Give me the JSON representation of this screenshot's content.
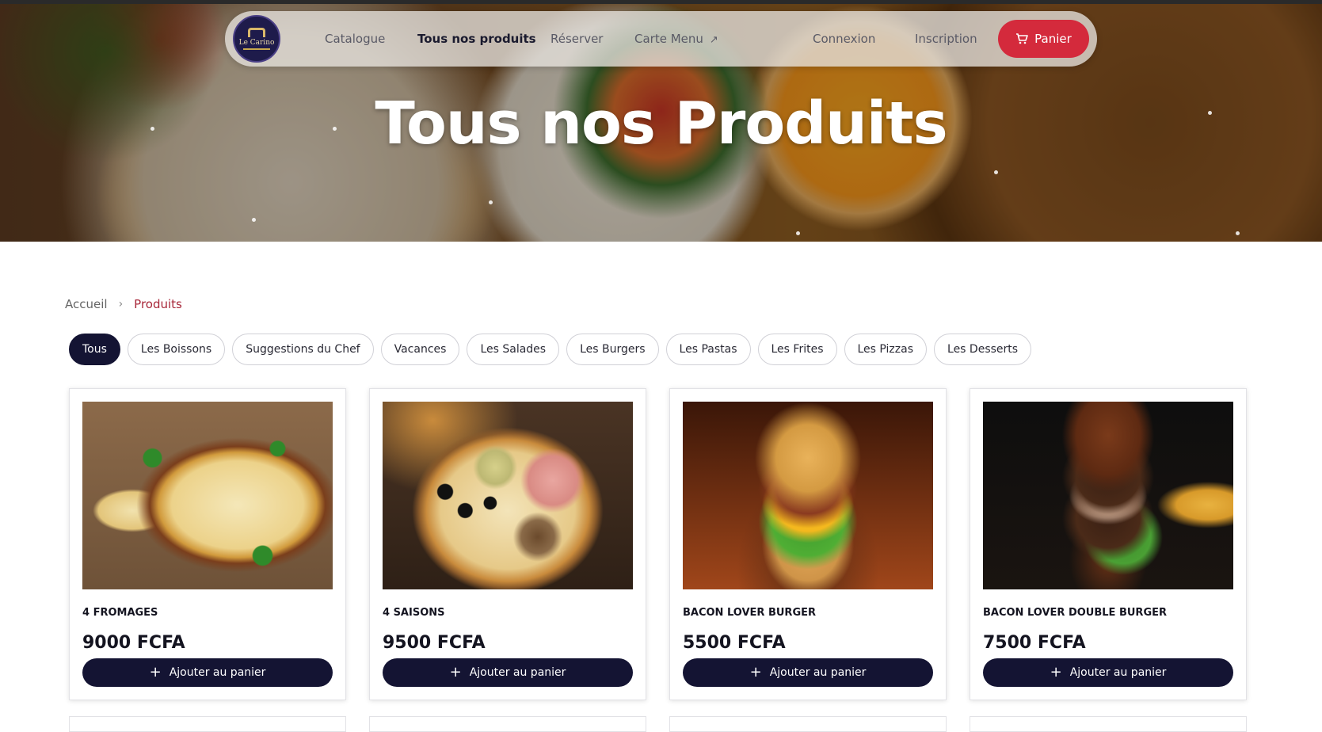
{
  "nav": {
    "logo_text": "Le Carino",
    "links": {
      "catalogue": "Catalogue",
      "all_products": "Tous nos produits",
      "reserve": "Réserver",
      "menu_card": "Carte Menu",
      "menu_card_icon": "↗",
      "login": "Connexion",
      "signup": "Inscription"
    },
    "cart_label": "Panier",
    "cart_icon": "shopping-cart-icon"
  },
  "hero": {
    "title": "Tous nos Produits"
  },
  "breadcrumb": {
    "home": "Accueil",
    "separator": "›",
    "current": "Produits"
  },
  "categories": [
    "Tous",
    "Les Boissons",
    "Suggestions du Chef",
    "Vacances",
    "Les Salades",
    "Les Burgers",
    "Les Pastas",
    "Les Frites",
    "Les Pizzas",
    "Les Desserts"
  ],
  "active_category": "Tous",
  "products": [
    {
      "name": "4 FROMAGES",
      "price": "9000 FCFA",
      "image": "pizza-quatre-fromages"
    },
    {
      "name": "4 SAISONS",
      "price": "9500 FCFA",
      "image": "pizza-quatre-saisons"
    },
    {
      "name": "BACON LOVER BURGER",
      "price": "5500 FCFA",
      "image": "bacon-burger"
    },
    {
      "name": "BACON LOVER DOUBLE BURGER",
      "price": "7500 FCFA",
      "image": "double-bacon-burger"
    }
  ],
  "add_to_cart_label": "Ajouter au panier",
  "add_icon": "+",
  "colors": {
    "primary_navy": "#141433",
    "accent_red": "#d42a3c",
    "breadcrumb_active": "#a8283a"
  }
}
